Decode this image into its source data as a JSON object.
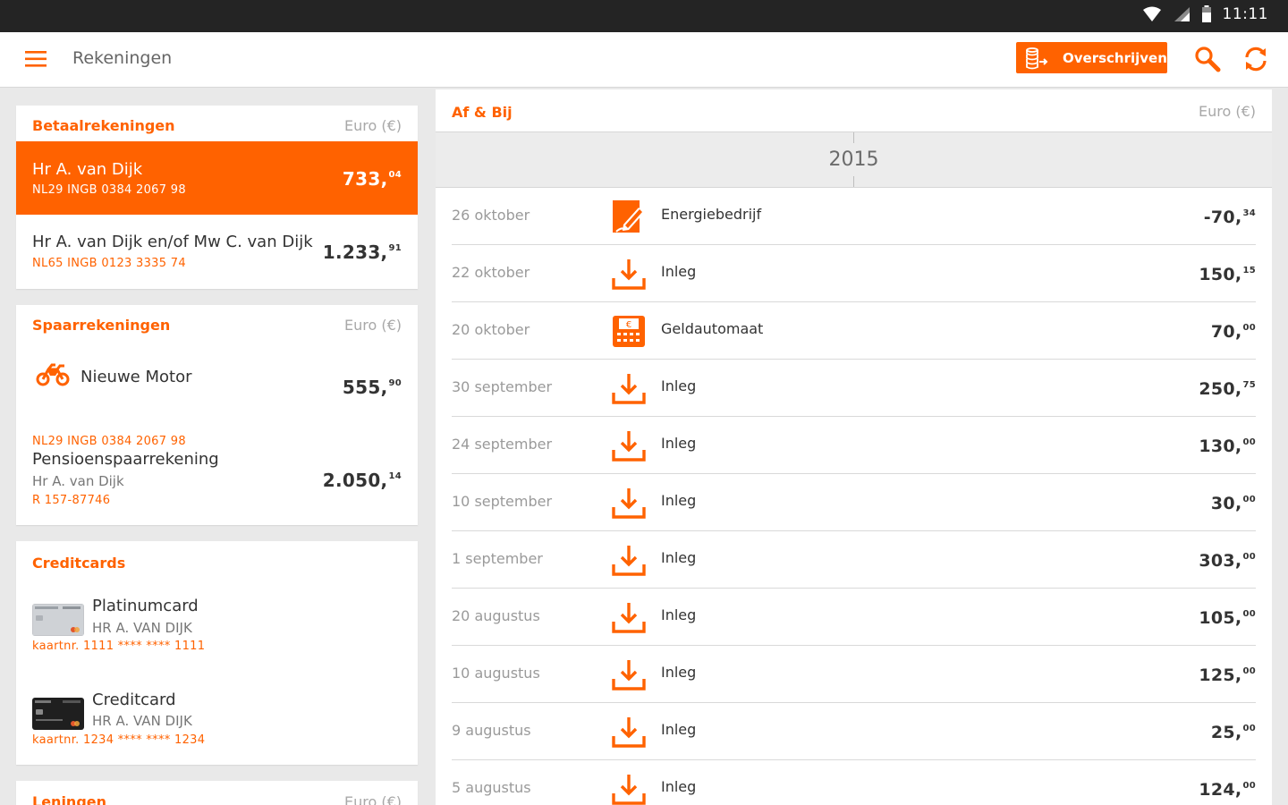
{
  "status_bar": {
    "time": "11:11"
  },
  "toolbar": {
    "title": "Rekeningen",
    "transfer_label": "Overschrijven"
  },
  "colors": {
    "accent": "#ff6200",
    "status_bar": "#242424"
  },
  "betaal": {
    "title": "Betaalrekeningen",
    "currency": "Euro (€)",
    "accounts": [
      {
        "name": "Hr A. van Dijk",
        "iban": "NL29 INGB 0384 2067 98",
        "amount_main": "733,",
        "amount_cents": "04"
      },
      {
        "name": "Hr A. van Dijk en/of Mw C. van Dijk",
        "iban": "NL65 INGB 0123 3335 74",
        "amount_main": "1.233,",
        "amount_cents": "91"
      }
    ]
  },
  "spaar": {
    "title": "Spaarrekeningen",
    "currency": "Euro (€)",
    "accounts": [
      {
        "name": "Nieuwe Motor",
        "icon": "motorcycle-icon",
        "iban": "NL29 INGB 0384 2067 98",
        "amount_main": "555,",
        "amount_cents": "90"
      },
      {
        "name": "Pensioenspaarrekening",
        "holder": "Hr A. van Dijk",
        "iban": "R 157-87746",
        "amount_main": "2.050,",
        "amount_cents": "14"
      }
    ]
  },
  "credit": {
    "title": "Creditcards",
    "cards": [
      {
        "name": "Platinumcard",
        "holder": "HR A. VAN DIJK",
        "number": "kaartnr. 1111 **** **** 1111"
      },
      {
        "name": "Creditcard",
        "holder": "HR A. VAN DIJK",
        "number": "kaartnr. 1234 **** **** 1234"
      }
    ]
  },
  "leningen": {
    "title": "Leningen",
    "currency": "Euro (€)"
  },
  "af_bij": {
    "title": "Af & Bij",
    "currency": "Euro (€)",
    "year": "2015",
    "transactions": [
      {
        "date": "26 oktober",
        "icon": "bill-icon",
        "desc": "Energiebedrijf",
        "amount_main": "-70,",
        "amount_cents": "34"
      },
      {
        "date": "22 oktober",
        "icon": "deposit-icon",
        "desc": "Inleg",
        "amount_main": "150,",
        "amount_cents": "15"
      },
      {
        "date": "20 oktober",
        "icon": "atm-icon",
        "desc": "Geldautomaat",
        "amount_main": "70,",
        "amount_cents": "00"
      },
      {
        "date": "30 september",
        "icon": "deposit-icon",
        "desc": "Inleg",
        "amount_main": "250,",
        "amount_cents": "75"
      },
      {
        "date": "24 september",
        "icon": "deposit-icon",
        "desc": "Inleg",
        "amount_main": "130,",
        "amount_cents": "00"
      },
      {
        "date": "10 september",
        "icon": "deposit-icon",
        "desc": "Inleg",
        "amount_main": "30,",
        "amount_cents": "00"
      },
      {
        "date": "1 september",
        "icon": "deposit-icon",
        "desc": "Inleg",
        "amount_main": "303,",
        "amount_cents": "00"
      },
      {
        "date": "20 augustus",
        "icon": "deposit-icon",
        "desc": "Inleg",
        "amount_main": "105,",
        "amount_cents": "00"
      },
      {
        "date": "10 augustus",
        "icon": "deposit-icon",
        "desc": "Inleg",
        "amount_main": "125,",
        "amount_cents": "00"
      },
      {
        "date": "9 augustus",
        "icon": "deposit-icon",
        "desc": "Inleg",
        "amount_main": "25,",
        "amount_cents": "00"
      },
      {
        "date": "5 augustus",
        "icon": "deposit-icon",
        "desc": "Inleg",
        "amount_main": "124,",
        "amount_cents": "00"
      }
    ]
  }
}
